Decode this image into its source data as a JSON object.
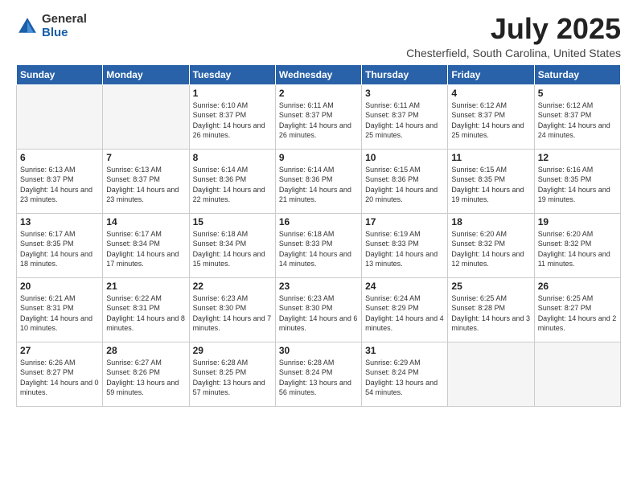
{
  "logo": {
    "general": "General",
    "blue": "Blue"
  },
  "header": {
    "month": "July 2025",
    "location": "Chesterfield, South Carolina, United States"
  },
  "days_of_week": [
    "Sunday",
    "Monday",
    "Tuesday",
    "Wednesday",
    "Thursday",
    "Friday",
    "Saturday"
  ],
  "weeks": [
    [
      {
        "day": "",
        "info": ""
      },
      {
        "day": "",
        "info": ""
      },
      {
        "day": "1",
        "info": "Sunrise: 6:10 AM\nSunset: 8:37 PM\nDaylight: 14 hours and 26 minutes."
      },
      {
        "day": "2",
        "info": "Sunrise: 6:11 AM\nSunset: 8:37 PM\nDaylight: 14 hours and 26 minutes."
      },
      {
        "day": "3",
        "info": "Sunrise: 6:11 AM\nSunset: 8:37 PM\nDaylight: 14 hours and 25 minutes."
      },
      {
        "day": "4",
        "info": "Sunrise: 6:12 AM\nSunset: 8:37 PM\nDaylight: 14 hours and 25 minutes."
      },
      {
        "day": "5",
        "info": "Sunrise: 6:12 AM\nSunset: 8:37 PM\nDaylight: 14 hours and 24 minutes."
      }
    ],
    [
      {
        "day": "6",
        "info": "Sunrise: 6:13 AM\nSunset: 8:37 PM\nDaylight: 14 hours and 23 minutes."
      },
      {
        "day": "7",
        "info": "Sunrise: 6:13 AM\nSunset: 8:37 PM\nDaylight: 14 hours and 23 minutes."
      },
      {
        "day": "8",
        "info": "Sunrise: 6:14 AM\nSunset: 8:36 PM\nDaylight: 14 hours and 22 minutes."
      },
      {
        "day": "9",
        "info": "Sunrise: 6:14 AM\nSunset: 8:36 PM\nDaylight: 14 hours and 21 minutes."
      },
      {
        "day": "10",
        "info": "Sunrise: 6:15 AM\nSunset: 8:36 PM\nDaylight: 14 hours and 20 minutes."
      },
      {
        "day": "11",
        "info": "Sunrise: 6:15 AM\nSunset: 8:35 PM\nDaylight: 14 hours and 19 minutes."
      },
      {
        "day": "12",
        "info": "Sunrise: 6:16 AM\nSunset: 8:35 PM\nDaylight: 14 hours and 19 minutes."
      }
    ],
    [
      {
        "day": "13",
        "info": "Sunrise: 6:17 AM\nSunset: 8:35 PM\nDaylight: 14 hours and 18 minutes."
      },
      {
        "day": "14",
        "info": "Sunrise: 6:17 AM\nSunset: 8:34 PM\nDaylight: 14 hours and 17 minutes."
      },
      {
        "day": "15",
        "info": "Sunrise: 6:18 AM\nSunset: 8:34 PM\nDaylight: 14 hours and 15 minutes."
      },
      {
        "day": "16",
        "info": "Sunrise: 6:18 AM\nSunset: 8:33 PM\nDaylight: 14 hours and 14 minutes."
      },
      {
        "day": "17",
        "info": "Sunrise: 6:19 AM\nSunset: 8:33 PM\nDaylight: 14 hours and 13 minutes."
      },
      {
        "day": "18",
        "info": "Sunrise: 6:20 AM\nSunset: 8:32 PM\nDaylight: 14 hours and 12 minutes."
      },
      {
        "day": "19",
        "info": "Sunrise: 6:20 AM\nSunset: 8:32 PM\nDaylight: 14 hours and 11 minutes."
      }
    ],
    [
      {
        "day": "20",
        "info": "Sunrise: 6:21 AM\nSunset: 8:31 PM\nDaylight: 14 hours and 10 minutes."
      },
      {
        "day": "21",
        "info": "Sunrise: 6:22 AM\nSunset: 8:31 PM\nDaylight: 14 hours and 8 minutes."
      },
      {
        "day": "22",
        "info": "Sunrise: 6:23 AM\nSunset: 8:30 PM\nDaylight: 14 hours and 7 minutes."
      },
      {
        "day": "23",
        "info": "Sunrise: 6:23 AM\nSunset: 8:30 PM\nDaylight: 14 hours and 6 minutes."
      },
      {
        "day": "24",
        "info": "Sunrise: 6:24 AM\nSunset: 8:29 PM\nDaylight: 14 hours and 4 minutes."
      },
      {
        "day": "25",
        "info": "Sunrise: 6:25 AM\nSunset: 8:28 PM\nDaylight: 14 hours and 3 minutes."
      },
      {
        "day": "26",
        "info": "Sunrise: 6:25 AM\nSunset: 8:27 PM\nDaylight: 14 hours and 2 minutes."
      }
    ],
    [
      {
        "day": "27",
        "info": "Sunrise: 6:26 AM\nSunset: 8:27 PM\nDaylight: 14 hours and 0 minutes."
      },
      {
        "day": "28",
        "info": "Sunrise: 6:27 AM\nSunset: 8:26 PM\nDaylight: 13 hours and 59 minutes."
      },
      {
        "day": "29",
        "info": "Sunrise: 6:28 AM\nSunset: 8:25 PM\nDaylight: 13 hours and 57 minutes."
      },
      {
        "day": "30",
        "info": "Sunrise: 6:28 AM\nSunset: 8:24 PM\nDaylight: 13 hours and 56 minutes."
      },
      {
        "day": "31",
        "info": "Sunrise: 6:29 AM\nSunset: 8:24 PM\nDaylight: 13 hours and 54 minutes."
      },
      {
        "day": "",
        "info": ""
      },
      {
        "day": "",
        "info": ""
      }
    ]
  ]
}
